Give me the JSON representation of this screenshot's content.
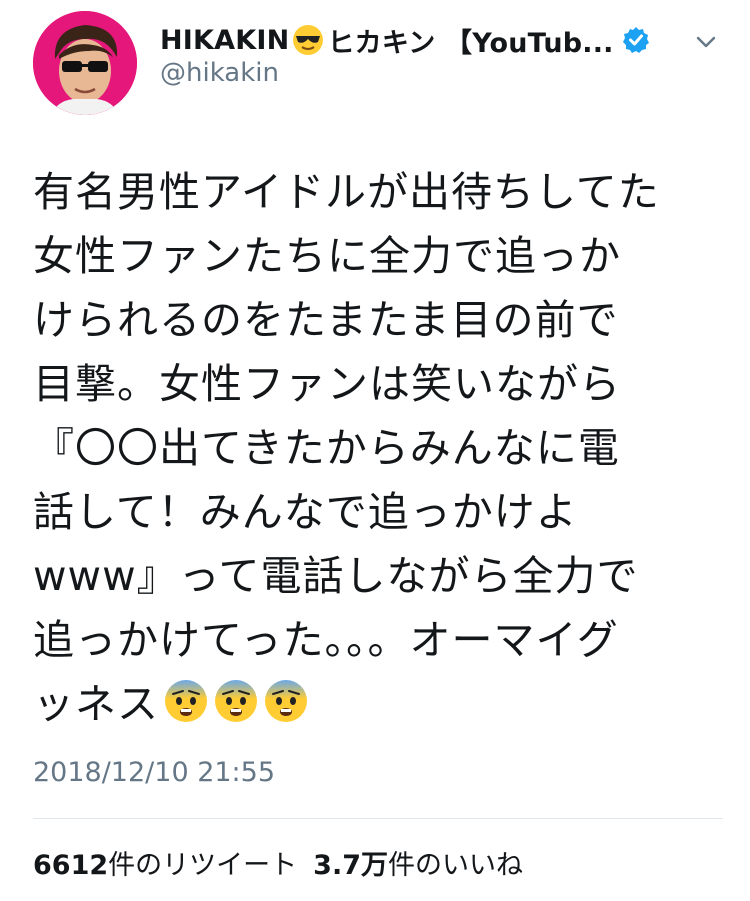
{
  "user": {
    "display_name": "HIKAKIN",
    "display_name_suffix": "ヒカキン 【YouTub...",
    "handle": "@hikakin",
    "name_emoji": "smiling-face-with-sunglasses-emoji",
    "verified": true
  },
  "tweet": {
    "lines": [
      "有名男性アイドルが出待ちしてた",
      "女性ファンたちに全力で追っか",
      "けられるのをたまたま目の前で",
      "目撃。女性ファンは笑いながら",
      "『〇〇出てきたからみんなに電",
      "話して！みんなで追っかけよ",
      "www』って電話しながら全力で",
      "追っかけてった。。。オーマイグ"
    ],
    "last_line": "ッネス",
    "trailing_emoji": [
      "fearful-face-emoji",
      "fearful-face-emoji",
      "fearful-face-emoji"
    ]
  },
  "timestamp": "2018/12/10 21:55",
  "stats": {
    "retweet_count": "6612",
    "retweet_label": "件のリツイート",
    "like_count": "3.7万",
    "like_label": "件のいいね"
  },
  "colors": {
    "avatar_bg": "#e5177a",
    "verified": "#1da1f2",
    "secondary_text": "#657786",
    "divider": "#e1e8ed"
  }
}
